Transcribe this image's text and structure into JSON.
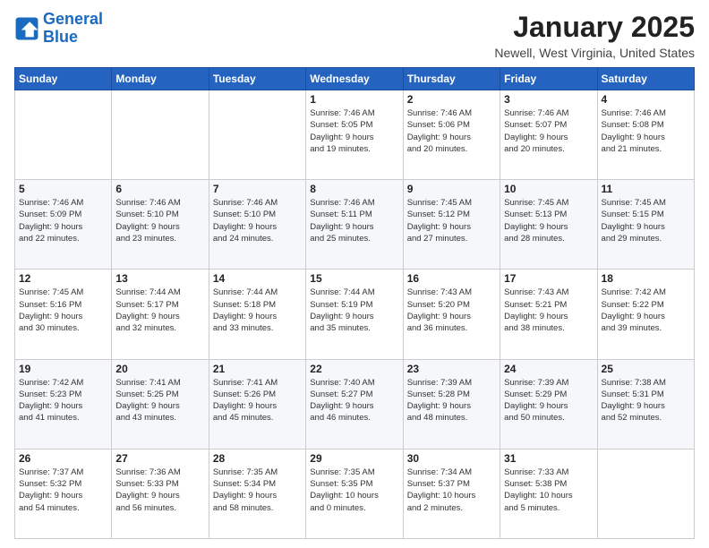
{
  "header": {
    "logo_line1": "General",
    "logo_line2": "Blue",
    "month": "January 2025",
    "location": "Newell, West Virginia, United States"
  },
  "weekdays": [
    "Sunday",
    "Monday",
    "Tuesday",
    "Wednesday",
    "Thursday",
    "Friday",
    "Saturday"
  ],
  "weeks": [
    [
      {
        "day": "",
        "info": ""
      },
      {
        "day": "",
        "info": ""
      },
      {
        "day": "",
        "info": ""
      },
      {
        "day": "1",
        "info": "Sunrise: 7:46 AM\nSunset: 5:05 PM\nDaylight: 9 hours\nand 19 minutes."
      },
      {
        "day": "2",
        "info": "Sunrise: 7:46 AM\nSunset: 5:06 PM\nDaylight: 9 hours\nand 20 minutes."
      },
      {
        "day": "3",
        "info": "Sunrise: 7:46 AM\nSunset: 5:07 PM\nDaylight: 9 hours\nand 20 minutes."
      },
      {
        "day": "4",
        "info": "Sunrise: 7:46 AM\nSunset: 5:08 PM\nDaylight: 9 hours\nand 21 minutes."
      }
    ],
    [
      {
        "day": "5",
        "info": "Sunrise: 7:46 AM\nSunset: 5:09 PM\nDaylight: 9 hours\nand 22 minutes."
      },
      {
        "day": "6",
        "info": "Sunrise: 7:46 AM\nSunset: 5:10 PM\nDaylight: 9 hours\nand 23 minutes."
      },
      {
        "day": "7",
        "info": "Sunrise: 7:46 AM\nSunset: 5:10 PM\nDaylight: 9 hours\nand 24 minutes."
      },
      {
        "day": "8",
        "info": "Sunrise: 7:46 AM\nSunset: 5:11 PM\nDaylight: 9 hours\nand 25 minutes."
      },
      {
        "day": "9",
        "info": "Sunrise: 7:45 AM\nSunset: 5:12 PM\nDaylight: 9 hours\nand 27 minutes."
      },
      {
        "day": "10",
        "info": "Sunrise: 7:45 AM\nSunset: 5:13 PM\nDaylight: 9 hours\nand 28 minutes."
      },
      {
        "day": "11",
        "info": "Sunrise: 7:45 AM\nSunset: 5:15 PM\nDaylight: 9 hours\nand 29 minutes."
      }
    ],
    [
      {
        "day": "12",
        "info": "Sunrise: 7:45 AM\nSunset: 5:16 PM\nDaylight: 9 hours\nand 30 minutes."
      },
      {
        "day": "13",
        "info": "Sunrise: 7:44 AM\nSunset: 5:17 PM\nDaylight: 9 hours\nand 32 minutes."
      },
      {
        "day": "14",
        "info": "Sunrise: 7:44 AM\nSunset: 5:18 PM\nDaylight: 9 hours\nand 33 minutes."
      },
      {
        "day": "15",
        "info": "Sunrise: 7:44 AM\nSunset: 5:19 PM\nDaylight: 9 hours\nand 35 minutes."
      },
      {
        "day": "16",
        "info": "Sunrise: 7:43 AM\nSunset: 5:20 PM\nDaylight: 9 hours\nand 36 minutes."
      },
      {
        "day": "17",
        "info": "Sunrise: 7:43 AM\nSunset: 5:21 PM\nDaylight: 9 hours\nand 38 minutes."
      },
      {
        "day": "18",
        "info": "Sunrise: 7:42 AM\nSunset: 5:22 PM\nDaylight: 9 hours\nand 39 minutes."
      }
    ],
    [
      {
        "day": "19",
        "info": "Sunrise: 7:42 AM\nSunset: 5:23 PM\nDaylight: 9 hours\nand 41 minutes."
      },
      {
        "day": "20",
        "info": "Sunrise: 7:41 AM\nSunset: 5:25 PM\nDaylight: 9 hours\nand 43 minutes."
      },
      {
        "day": "21",
        "info": "Sunrise: 7:41 AM\nSunset: 5:26 PM\nDaylight: 9 hours\nand 45 minutes."
      },
      {
        "day": "22",
        "info": "Sunrise: 7:40 AM\nSunset: 5:27 PM\nDaylight: 9 hours\nand 46 minutes."
      },
      {
        "day": "23",
        "info": "Sunrise: 7:39 AM\nSunset: 5:28 PM\nDaylight: 9 hours\nand 48 minutes."
      },
      {
        "day": "24",
        "info": "Sunrise: 7:39 AM\nSunset: 5:29 PM\nDaylight: 9 hours\nand 50 minutes."
      },
      {
        "day": "25",
        "info": "Sunrise: 7:38 AM\nSunset: 5:31 PM\nDaylight: 9 hours\nand 52 minutes."
      }
    ],
    [
      {
        "day": "26",
        "info": "Sunrise: 7:37 AM\nSunset: 5:32 PM\nDaylight: 9 hours\nand 54 minutes."
      },
      {
        "day": "27",
        "info": "Sunrise: 7:36 AM\nSunset: 5:33 PM\nDaylight: 9 hours\nand 56 minutes."
      },
      {
        "day": "28",
        "info": "Sunrise: 7:35 AM\nSunset: 5:34 PM\nDaylight: 9 hours\nand 58 minutes."
      },
      {
        "day": "29",
        "info": "Sunrise: 7:35 AM\nSunset: 5:35 PM\nDaylight: 10 hours\nand 0 minutes."
      },
      {
        "day": "30",
        "info": "Sunrise: 7:34 AM\nSunset: 5:37 PM\nDaylight: 10 hours\nand 2 minutes."
      },
      {
        "day": "31",
        "info": "Sunrise: 7:33 AM\nSunset: 5:38 PM\nDaylight: 10 hours\nand 5 minutes."
      },
      {
        "day": "",
        "info": ""
      }
    ]
  ]
}
